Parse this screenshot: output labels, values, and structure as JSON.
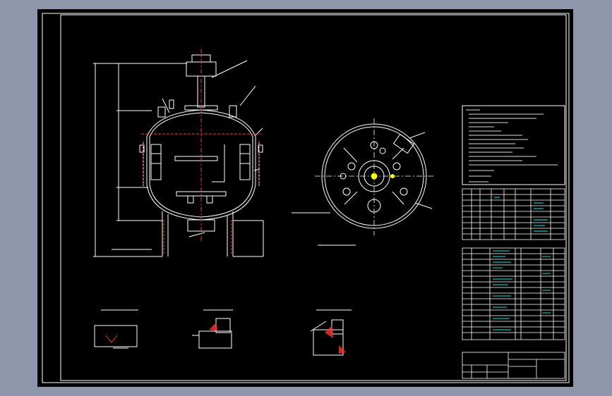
{
  "viewer": {
    "background": "#8e96ab",
    "sheet_color": "#000000",
    "line_color": "#ffffff",
    "centerline_color": "#ff3333",
    "hatch_color": "#ff3333",
    "highlight_color": "#ffff00",
    "table_text_color": "#00ffff"
  },
  "drawing": {
    "front_view_label": "",
    "top_view_label": "",
    "detail_labels": [
      "",
      "",
      ""
    ],
    "title_block_text": ""
  }
}
